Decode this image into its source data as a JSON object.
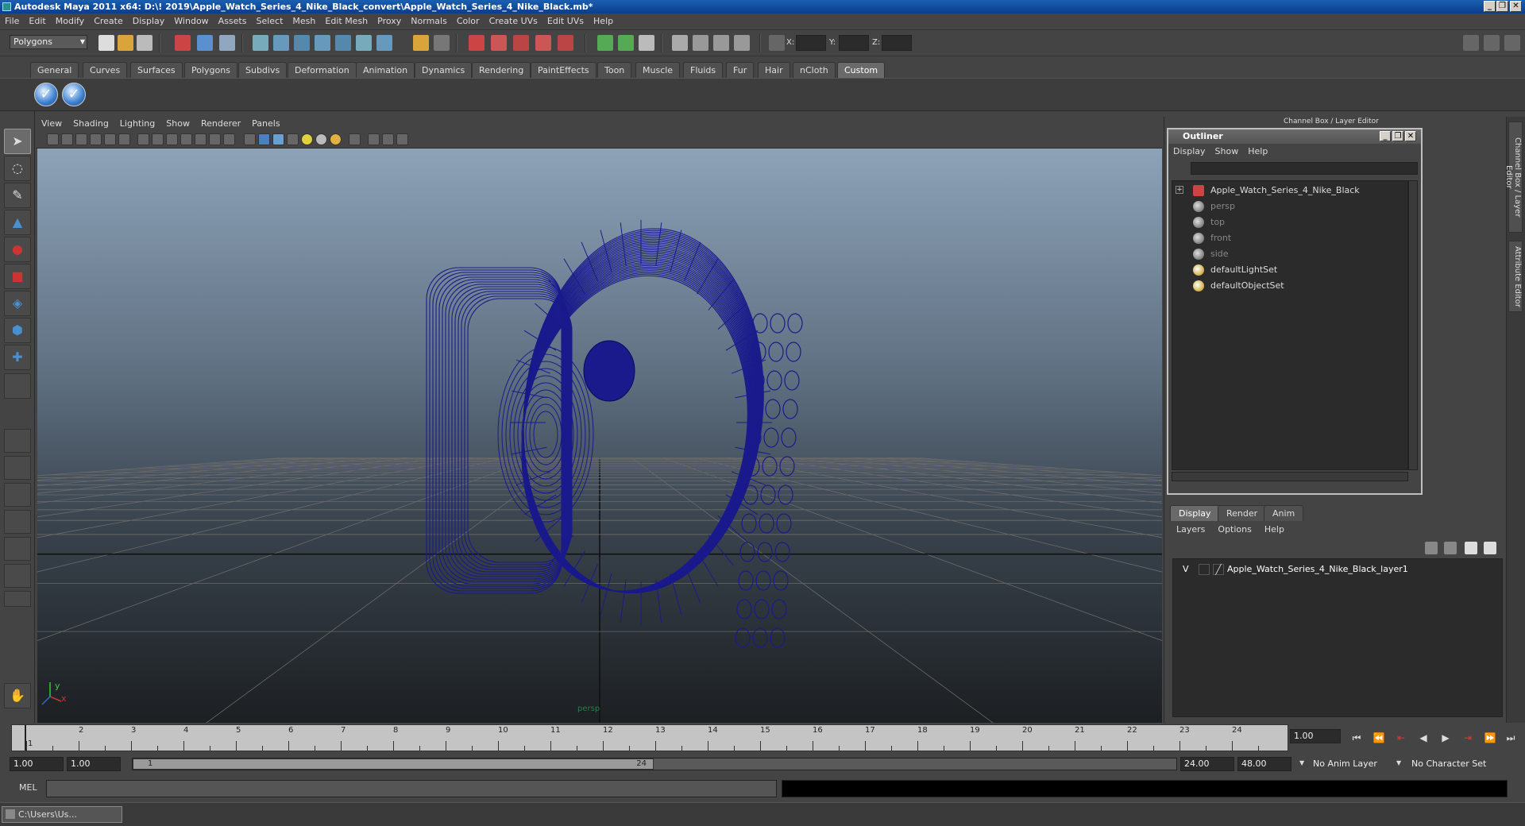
{
  "window": {
    "title": "Autodesk Maya 2011 x64: D:\\! 2019\\Apple_Watch_Series_4_Nike_Black_convert\\Apple_Watch_Series_4_Nike_Black.mb*",
    "minimize": "_",
    "restore": "❐",
    "close": "✕"
  },
  "menubar": [
    "File",
    "Edit",
    "Modify",
    "Create",
    "Display",
    "Window",
    "Assets",
    "Select",
    "Mesh",
    "Edit Mesh",
    "Proxy",
    "Normals",
    "Color",
    "Create UVs",
    "Edit UVs",
    "Help"
  ],
  "status_line": {
    "mode_selector": "Polygons",
    "coord_x": "X:",
    "coord_y": "Y:",
    "coord_z": "Z:"
  },
  "shelf_tabs": [
    "General",
    "Curves",
    "Surfaces",
    "Polygons",
    "Subdivs",
    "Deformation",
    "Animation",
    "Dynamics",
    "Rendering",
    "PaintEffects",
    "Toon",
    "Muscle",
    "Fluids",
    "Fur",
    "Hair",
    "nCloth",
    "Custom"
  ],
  "active_shelf_tab": "Custom",
  "panel_menus": [
    "View",
    "Shading",
    "Lighting",
    "Show",
    "Renderer",
    "Panels"
  ],
  "viewport": {
    "camera_label": "persp",
    "axis_y": "y",
    "axis_x": "x",
    "wire_color": "#1a1a8c"
  },
  "channel_box_title": "Channel Box / Layer Editor",
  "outliner": {
    "title": "Outliner",
    "menus": [
      "Display",
      "Show",
      "Help"
    ],
    "items": [
      {
        "label": "Apple_Watch_Series_4_Nike_Black",
        "dim": false
      },
      {
        "label": "persp",
        "dim": true
      },
      {
        "label": "top",
        "dim": true
      },
      {
        "label": "front",
        "dim": true
      },
      {
        "label": "side",
        "dim": true
      },
      {
        "label": "defaultLightSet",
        "dim": false
      },
      {
        "label": "defaultObjectSet",
        "dim": false
      }
    ]
  },
  "layer_editor": {
    "tabs": [
      "Display",
      "Render",
      "Anim"
    ],
    "active_tab": "Display",
    "menus": [
      "Layers",
      "Options",
      "Help"
    ],
    "layer_visibility": "V",
    "layer_name": "Apple_Watch_Series_4_Nike_Black_layer1"
  },
  "side_tabs": [
    "Channel Box / Layer Editor",
    "Attribute Editor"
  ],
  "time_slider": {
    "ticks": [
      "1",
      "2",
      "3",
      "4",
      "5",
      "6",
      "7",
      "8",
      "9",
      "10",
      "11",
      "12",
      "13",
      "14",
      "15",
      "16",
      "17",
      "18",
      "19",
      "20",
      "21",
      "22",
      "23",
      "24"
    ],
    "current_frame_marker": "1",
    "current_time": "1.00"
  },
  "range": {
    "start_time": "1.00",
    "playback_start": "1.00",
    "range_start": "1",
    "range_end": "24",
    "playback_end": "24.00",
    "end_time": "48.00",
    "anim_layer": "No Anim Layer",
    "character_set": "No Character Set"
  },
  "command_line": {
    "label": "MEL"
  },
  "taskbar": {
    "item": "C:\\Users\\Us..."
  }
}
